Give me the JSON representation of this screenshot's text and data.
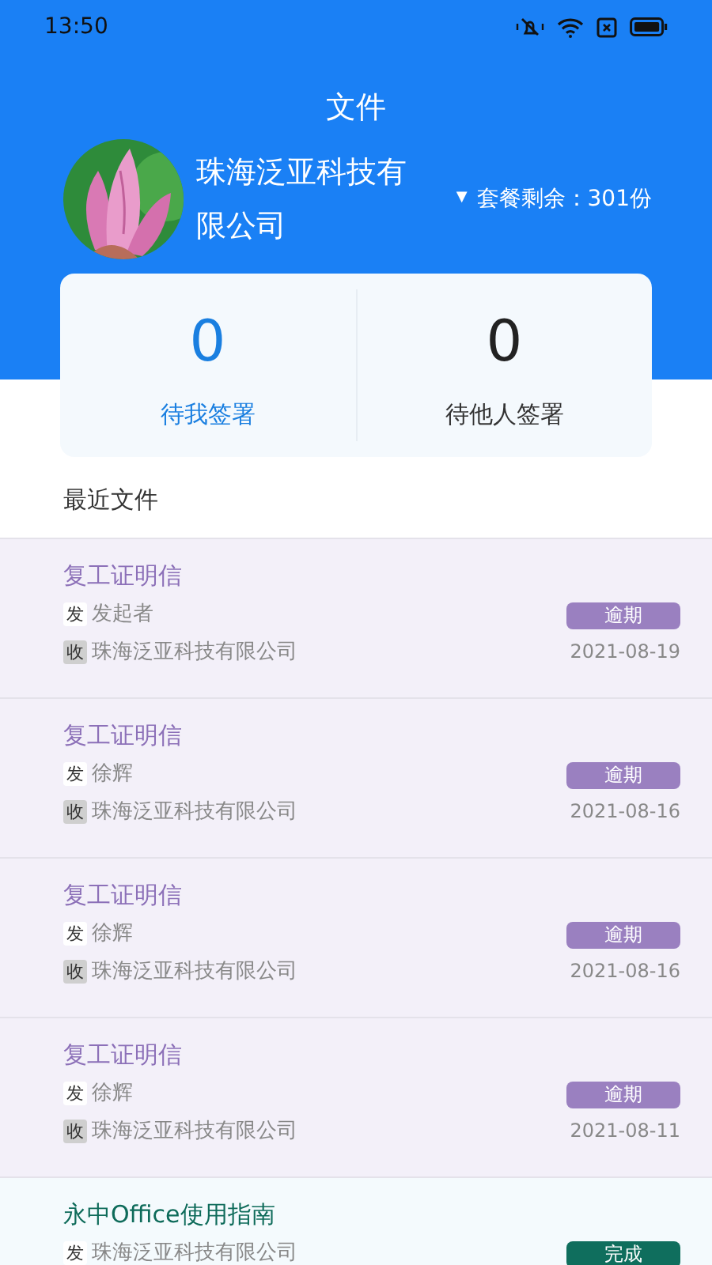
{
  "status_bar": {
    "time": "13:50"
  },
  "header": {
    "title": "文件"
  },
  "profile": {
    "company": "珠海泛亚科技有限公司",
    "caret": "▼",
    "quota": "套餐剩余：301份"
  },
  "counters": [
    {
      "value": "0",
      "label": "待我签署",
      "selected": true
    },
    {
      "value": "0",
      "label": "待他人签署",
      "selected": false
    }
  ],
  "section_title": "最近文件",
  "documents": [
    {
      "title": "复工证明信",
      "sender_tag": "发",
      "sender": "发起者",
      "receiver_tag": "收",
      "receiver": "珠海泛亚科技有限公司",
      "status": "逾期",
      "kind": "overdue",
      "date": "2021-08-19"
    },
    {
      "title": "复工证明信",
      "sender_tag": "发",
      "sender": "徐辉",
      "receiver_tag": "收",
      "receiver": "珠海泛亚科技有限公司",
      "status": "逾期",
      "kind": "overdue",
      "date": "2021-08-16"
    },
    {
      "title": "复工证明信",
      "sender_tag": "发",
      "sender": "徐辉",
      "receiver_tag": "收",
      "receiver": "珠海泛亚科技有限公司",
      "status": "逾期",
      "kind": "overdue",
      "date": "2021-08-16"
    },
    {
      "title": "复工证明信",
      "sender_tag": "发",
      "sender": "徐辉",
      "receiver_tag": "收",
      "receiver": "珠海泛亚科技有限公司",
      "status": "逾期",
      "kind": "overdue",
      "date": "2021-08-11"
    },
    {
      "title": "永中Office使用指南",
      "sender_tag": "发",
      "sender": "珠海泛亚科技有限公司",
      "status": "完成",
      "kind": "done"
    }
  ]
}
